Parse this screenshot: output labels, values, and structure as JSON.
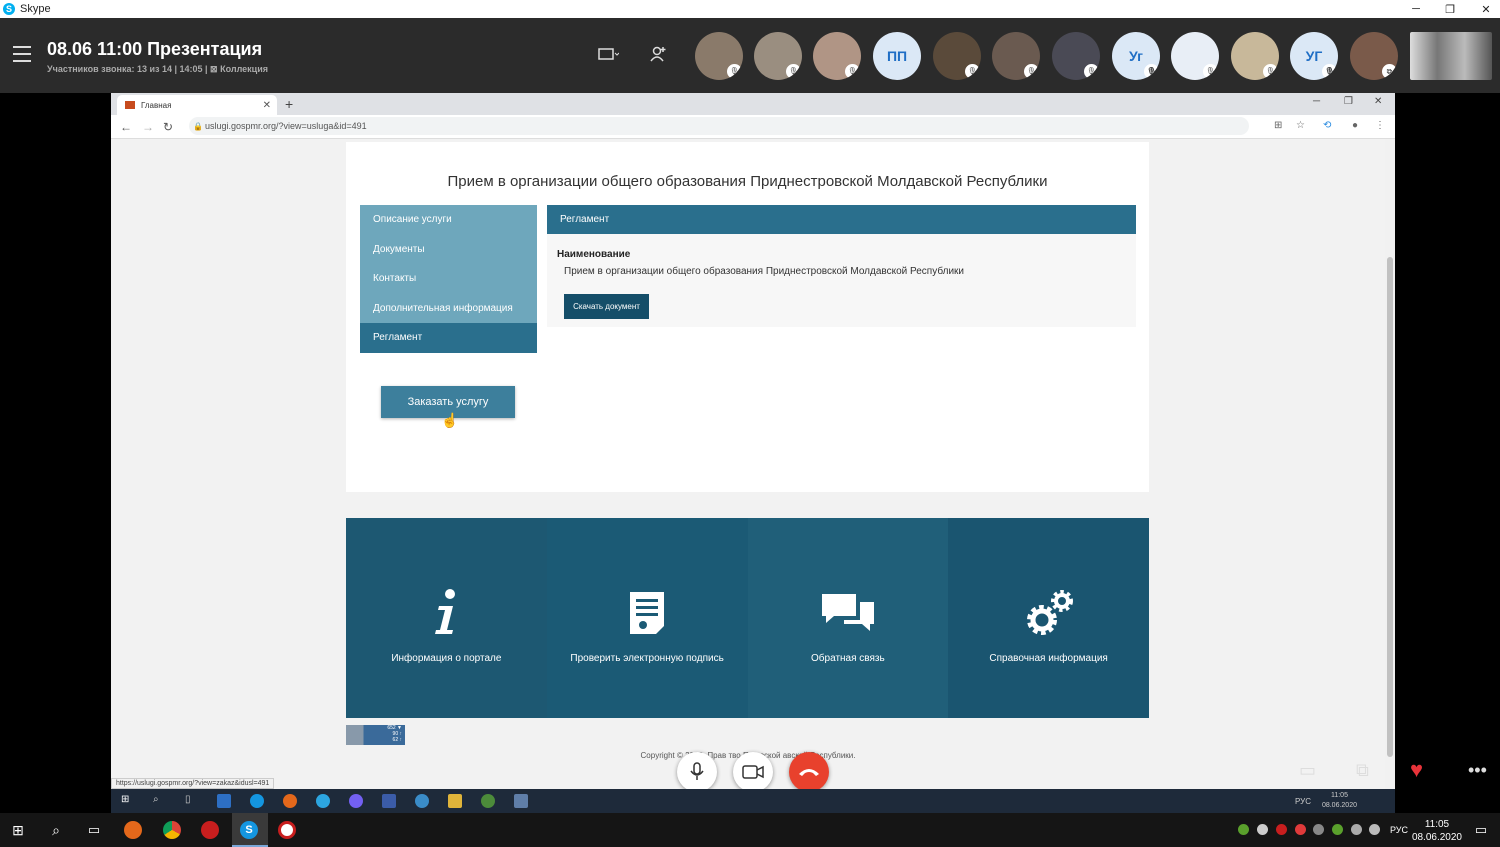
{
  "skype": {
    "app_title": "Skype",
    "call_title": "08.06 11:00 Презентация",
    "call_subtitle": "Участников звонка: 13 из 14 | 14:05 | ⊠ Коллекция",
    "participants": [
      {
        "type": "photo"
      },
      {
        "type": "photo"
      },
      {
        "type": "photo"
      },
      {
        "type": "initials",
        "text": "ПП"
      },
      {
        "type": "photo"
      },
      {
        "type": "photo"
      },
      {
        "type": "photo"
      },
      {
        "type": "initials",
        "text": "Уг"
      },
      {
        "type": "photo"
      },
      {
        "type": "photo"
      },
      {
        "type": "initials",
        "text": "УГ"
      },
      {
        "type": "photo"
      }
    ]
  },
  "browser": {
    "tab_title": "Главная",
    "url": "uslugi.gospmr.org/?view=usluga&id=491",
    "status_url": "https://uslugi.gospmr.org/?view=zakaz&idusl=491"
  },
  "page": {
    "title": "Прием в организации общего образования Приднестровской Молдавской Республики",
    "menu": [
      {
        "label": "Описание услуги",
        "active": false
      },
      {
        "label": "Документы",
        "active": false
      },
      {
        "label": "Контакты",
        "active": false
      },
      {
        "label": "Дополнительная информация",
        "active": false
      },
      {
        "label": "Регламент",
        "active": true
      }
    ],
    "order_button": "Заказать услугу",
    "panel": {
      "header": "Регламент",
      "name_label": "Наименование",
      "name_value": "Прием в организации общего образования Приднестровской Молдавской Республики",
      "download_button": "Скачать документ"
    },
    "tiles": [
      {
        "label": "Информация о портале"
      },
      {
        "label": "Проверить электронную подпись"
      },
      {
        "label": "Обратная связь"
      },
      {
        "label": "Справочная информация"
      }
    ],
    "counter": [
      "652 ▼",
      "90 ↑",
      "62 ↑"
    ],
    "copyright": "Copyright © 2018. Прав         тво При        вской         авской Республики."
  },
  "inner_taskbar": {
    "lang": "РУС",
    "time": "11:05",
    "date": "08.06.2020"
  },
  "taskbar": {
    "lang": "РУС",
    "time": "11:05",
    "date": "08.06.2020"
  },
  "colors": {
    "accent": "#2a6f8d",
    "menu_bg": "#6ea7bc",
    "tile_bg": "#1d5872",
    "end_call": "#e8412d"
  }
}
